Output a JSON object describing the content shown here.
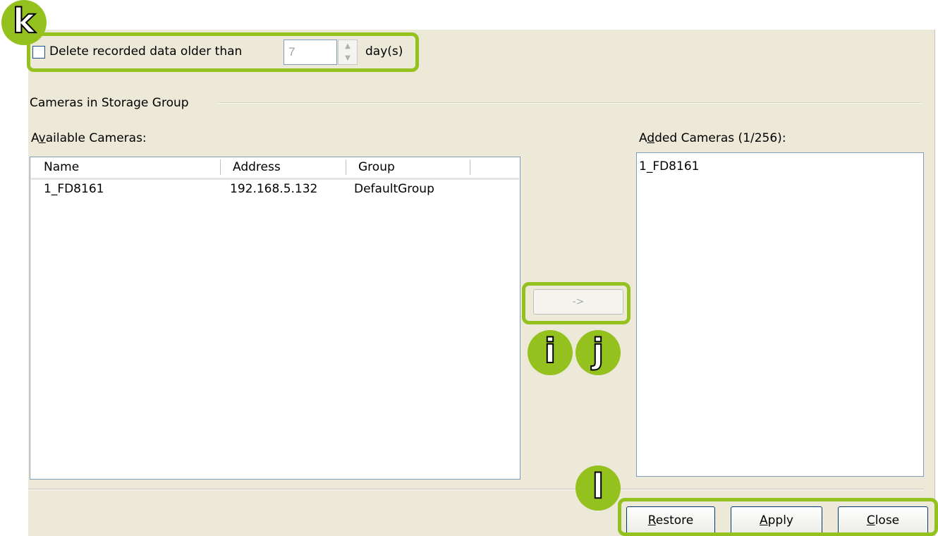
{
  "retention": {
    "checkbox_checked": false,
    "label": "Delete recorded data older than",
    "days_value": "7",
    "unit": "day(s)"
  },
  "group": {
    "title": "Cameras in Storage Group"
  },
  "available": {
    "label_pre": "A",
    "label_u": "v",
    "label_post": "ailable Cameras:",
    "columns": [
      "Name",
      "Address",
      "Group"
    ],
    "rows": [
      {
        "name": "1_FD8161",
        "address": "192.168.5.132",
        "group": "DefaultGroup"
      }
    ]
  },
  "transfer": {
    "arrow_label": "->"
  },
  "added": {
    "label_pre": "A",
    "label_u": "d",
    "label_post": "ded Cameras (1/256):",
    "items": [
      "1_FD8161"
    ]
  },
  "buttons": {
    "restore_u": "R",
    "restore_rest": "estore",
    "apply_u": "A",
    "apply_rest": "pply",
    "close_u": "C",
    "close_rest": "lose"
  },
  "annotations": {
    "k": "k",
    "i": "i",
    "j": "j",
    "l": "l",
    "color": "#95c11f"
  }
}
